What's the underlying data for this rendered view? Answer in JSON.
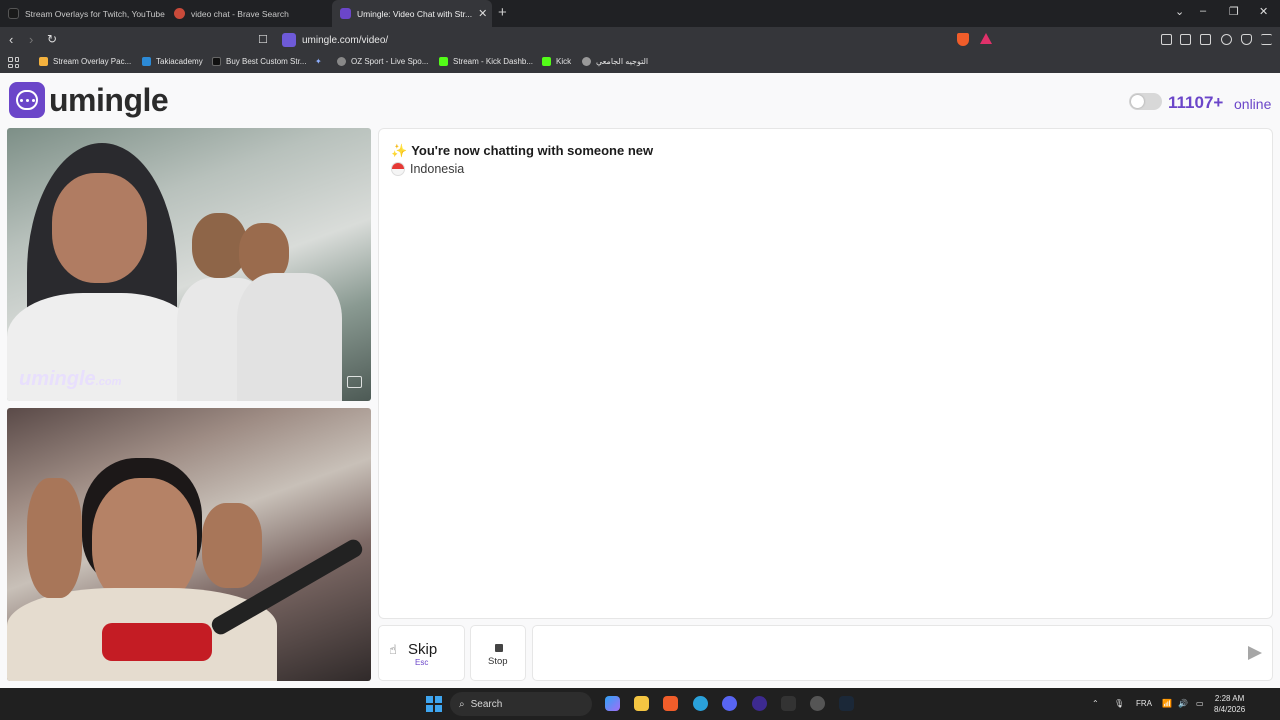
{
  "browser": {
    "tabs": [
      {
        "title": "Stream Overlays for Twitch, YouTube..."
      },
      {
        "title": "video chat - Brave Search"
      },
      {
        "title": "Umingle: Video Chat with Str..."
      }
    ],
    "url": "umingle.com/video/",
    "bookmarks": [
      {
        "label": "Stream Overlay Pac..."
      },
      {
        "label": "Takiacademy"
      },
      {
        "label": "Buy Best Custom Str..."
      },
      {
        "label": "OZ Sport - Live Spo..."
      },
      {
        "label": "Stream - Kick Dashb..."
      },
      {
        "label": "Kick"
      },
      {
        "label": "التوجيه الجامعي"
      }
    ]
  },
  "header": {
    "logo_text": "umingle",
    "online_count": "11107+",
    "online_label": "online"
  },
  "video": {
    "watermark": "umingle",
    "watermark_suffix": ".com"
  },
  "chat": {
    "sparkle": "✨",
    "status": "You're now chatting with someone new",
    "country": "Indonesia",
    "message_placeholder": ""
  },
  "controls": {
    "skip_label": "Skip",
    "skip_key": "Esc",
    "stop_label": "Stop"
  },
  "taskbar": {
    "search_label": "Search",
    "language": "FRA",
    "time": "2:28 AM",
    "date": "8/4/2026"
  },
  "colors": {
    "brand": "#6b46c9",
    "chrome_bg": "#35363a",
    "taskbar_bg": "#202020"
  }
}
